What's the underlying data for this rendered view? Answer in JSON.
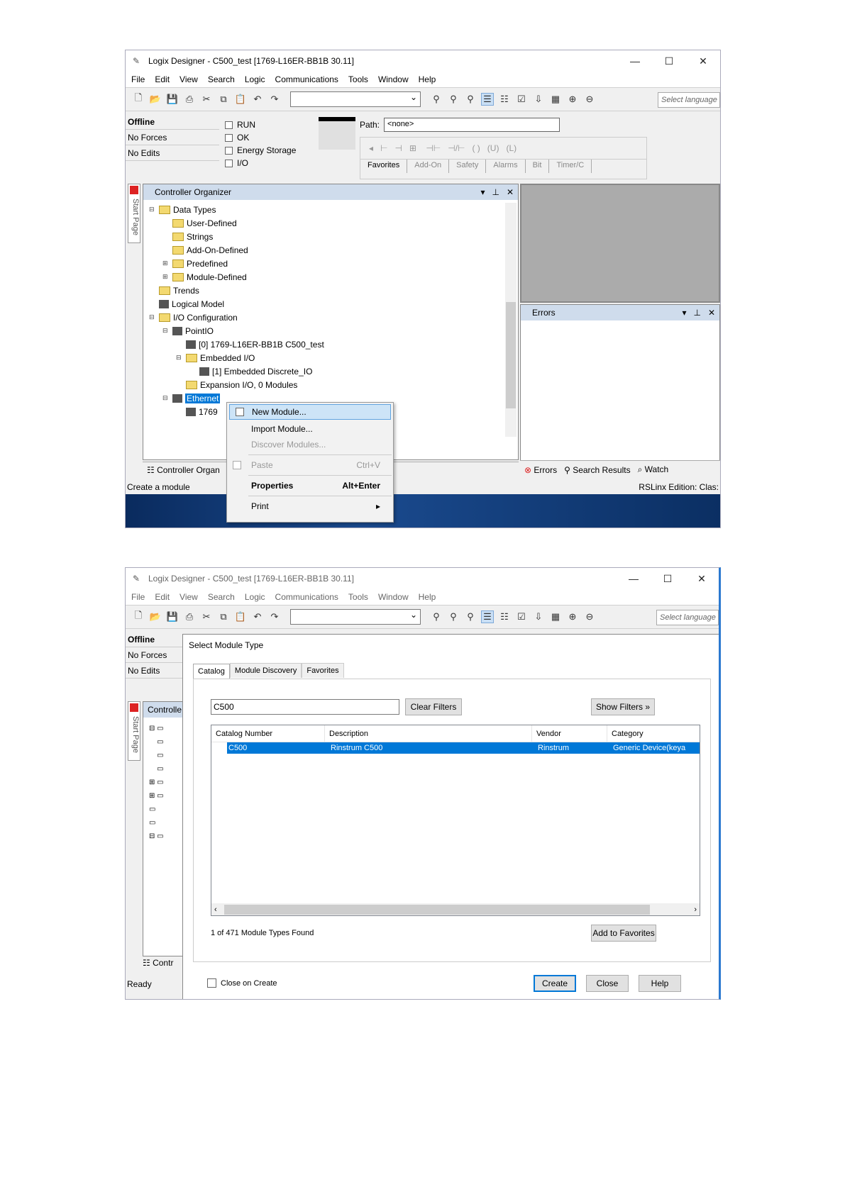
{
  "app": {
    "title": "Logix Designer - C500_test [1769-L16ER-BB1B 30.11]",
    "menu": [
      "File",
      "Edit",
      "View",
      "Search",
      "Logic",
      "Communications",
      "Tools",
      "Window",
      "Help"
    ],
    "lang_placeholder": "Select language"
  },
  "status": {
    "offline": "Offline",
    "forces": "No Forces",
    "edits": "No Edits",
    "checks": [
      "RUN",
      "OK",
      "Energy Storage",
      "I/O"
    ]
  },
  "path": {
    "label": "Path:",
    "value": "<none>"
  },
  "ladder_tabs": [
    "Favorites",
    "Add-On",
    "Safety",
    "Alarms",
    "Bit",
    "Timer/C"
  ],
  "organizer": {
    "title": "Controller Organizer",
    "start_page": "Start Page",
    "footer": "Controller Organ",
    "tree": [
      {
        "label": "Data Types",
        "level": 0,
        "exp": "⊟",
        "icon": "folder"
      },
      {
        "label": "User-Defined",
        "level": 1,
        "exp": "",
        "icon": "folder"
      },
      {
        "label": "Strings",
        "level": 1,
        "exp": "",
        "icon": "folder"
      },
      {
        "label": "Add-On-Defined",
        "level": 1,
        "exp": "",
        "icon": "folder"
      },
      {
        "label": "Predefined",
        "level": 1,
        "exp": "⊞",
        "icon": "folder"
      },
      {
        "label": "Module-Defined",
        "level": 1,
        "exp": "⊞",
        "icon": "folder"
      },
      {
        "label": "Trends",
        "level": 0,
        "exp": "",
        "icon": "folder"
      },
      {
        "label": "Logical Model",
        "level": 0,
        "exp": "",
        "icon": "dev"
      },
      {
        "label": "I/O Configuration",
        "level": 0,
        "exp": "⊟",
        "icon": "folder"
      },
      {
        "label": "PointIO",
        "level": 1,
        "exp": "⊟",
        "icon": "dev"
      },
      {
        "label": "[0] 1769-L16ER-BB1B C500_test",
        "level": 2,
        "exp": "",
        "icon": "dev"
      },
      {
        "label": "Embedded I/O",
        "level": 2,
        "exp": "⊟",
        "icon": "folder"
      },
      {
        "label": "[1] Embedded Discrete_IO",
        "level": 3,
        "exp": "",
        "icon": "dev"
      },
      {
        "label": "Expansion I/O, 0 Modules",
        "level": 2,
        "exp": "",
        "icon": "folder"
      },
      {
        "label": "Ethernet",
        "level": 1,
        "exp": "⊟",
        "icon": "dev",
        "selected": true
      },
      {
        "label": "1769",
        "level": 2,
        "exp": "",
        "icon": "dev"
      }
    ]
  },
  "context_menu": {
    "new_module": "New Module...",
    "import_module": "Import Module...",
    "discover": "Discover Modules...",
    "paste": "Paste",
    "paste_sc": "Ctrl+V",
    "properties": "Properties",
    "properties_sc": "Alt+Enter",
    "print": "Print"
  },
  "errors_panel": {
    "title": "Errors",
    "tabs": [
      "Errors",
      "Search Results",
      "Watch"
    ]
  },
  "statusbar": {
    "left1": "Create a module",
    "right1": "RSLinx Edition: Clas:",
    "left2": "Ready"
  },
  "dialog": {
    "title": "Select Module Type",
    "tabs": [
      "Catalog",
      "Module Discovery",
      "Favorites"
    ],
    "filter": "C500",
    "clear_filters": "Clear Filters",
    "show_filters": "Show Filters",
    "columns": [
      "Catalog Number",
      "Description",
      "Vendor",
      "Category"
    ],
    "row": [
      "C500",
      "Rinstrum C500",
      "Rinstrum",
      "Generic Device(keya"
    ],
    "found": "1 of 471 Module Types Found",
    "add_fav": "Add to Favorites",
    "close_on_create": "Close on Create",
    "create": "Create",
    "close": "Close",
    "help": "Help"
  },
  "second_left": {
    "org_title": "Controlle",
    "footer": "Contr"
  }
}
